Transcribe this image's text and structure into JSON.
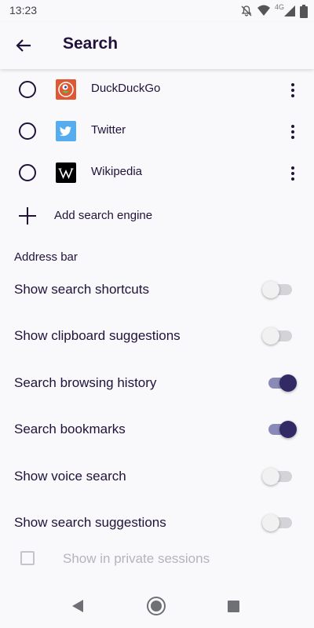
{
  "status_bar": {
    "time": "13:23",
    "network": "4G",
    "icons": [
      "notifications-off-icon",
      "wifi-icon",
      "cell-signal-icon",
      "battery-icon"
    ]
  },
  "app_bar": {
    "back_icon": "arrow-left-icon",
    "title": "Search"
  },
  "search_engines": [
    {
      "name": "DuckDuckGo",
      "icon": "duckduckgo-logo",
      "selected": false
    },
    {
      "name": "Twitter",
      "icon": "twitter-logo",
      "selected": false
    },
    {
      "name": "Wikipedia",
      "icon": "wikipedia-logo",
      "selected": false
    }
  ],
  "add_engine": {
    "label": "Add search engine",
    "icon": "plus-icon"
  },
  "address_bar": {
    "header": "Address bar",
    "settings": [
      {
        "label": "Show search shortcuts",
        "on": false
      },
      {
        "label": "Show clipboard suggestions",
        "on": false
      },
      {
        "label": "Search browsing history",
        "on": true
      },
      {
        "label": "Search bookmarks",
        "on": true
      },
      {
        "label": "Show voice search",
        "on": false
      },
      {
        "label": "Show search suggestions",
        "on": false
      }
    ],
    "private_sessions": {
      "label": "Show in private sessions",
      "checked": false,
      "enabled": false
    }
  },
  "colors": {
    "accent": "#312a65",
    "text": "#20123a",
    "background": "#f9f9fb"
  },
  "nav_bar": {
    "icons": [
      "nav-back-icon",
      "nav-home-icon",
      "nav-recents-icon"
    ]
  }
}
